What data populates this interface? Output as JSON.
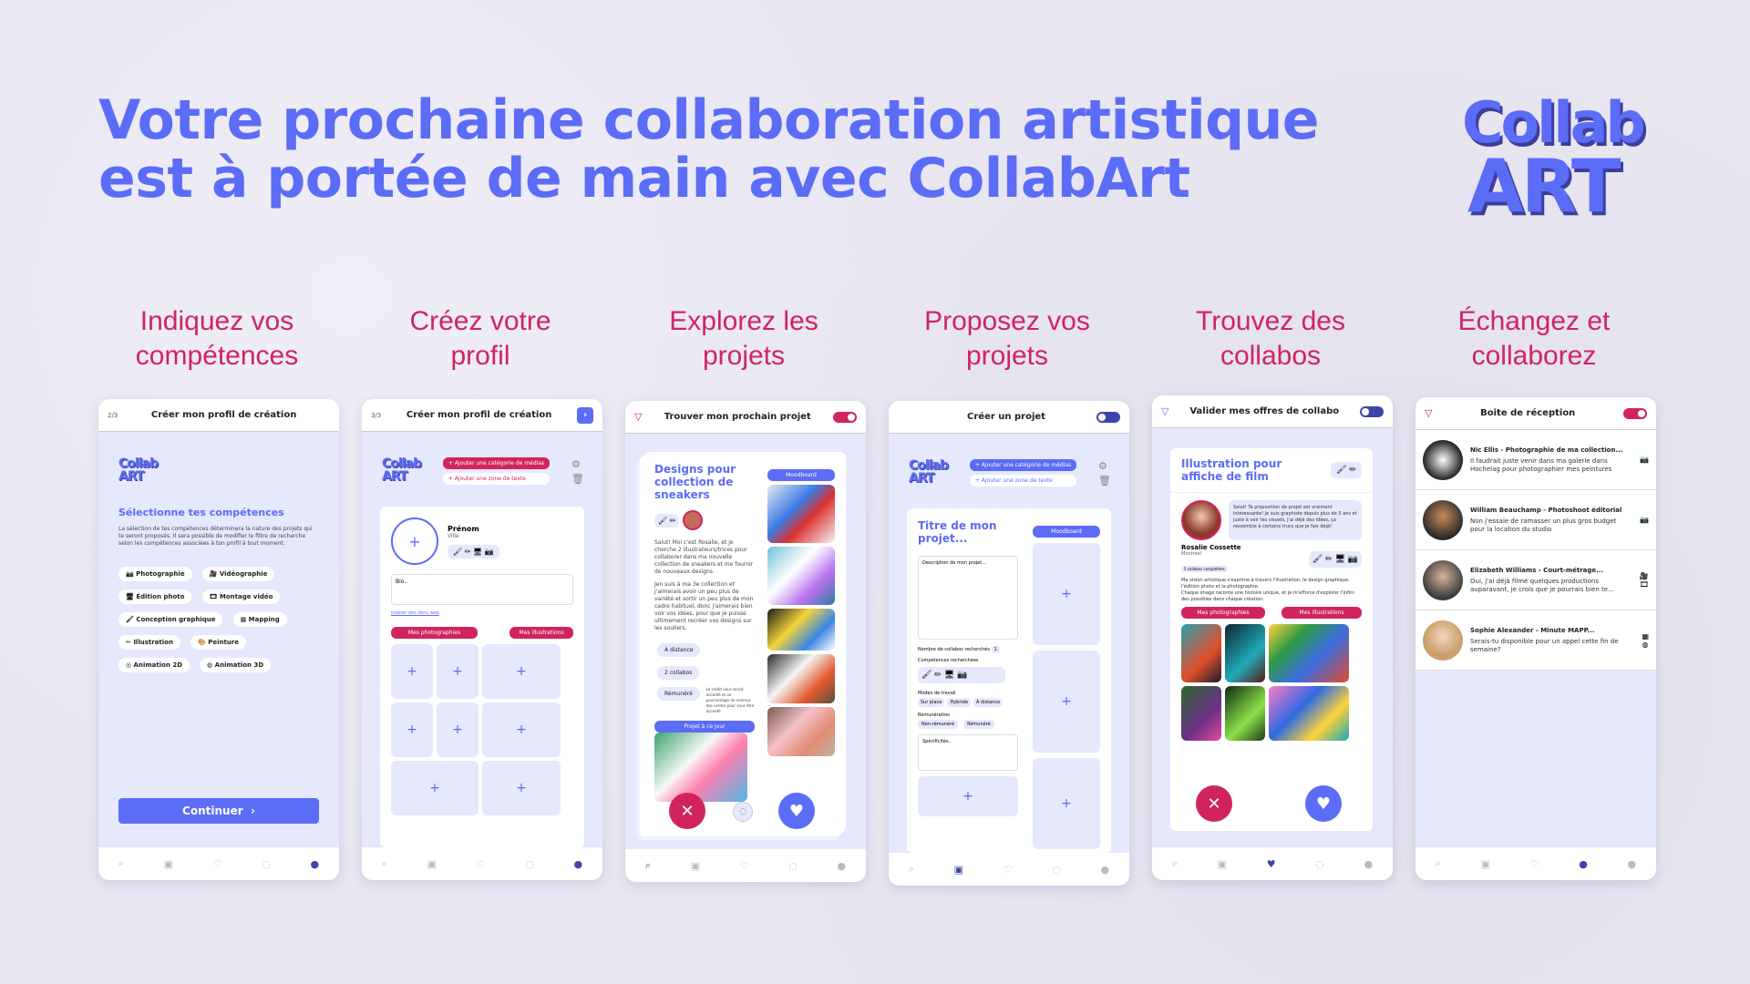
{
  "headline": {
    "line1": "Votre prochaine collaboration artistique",
    "line2": "est à portée de main avec CollabArt"
  },
  "logo": {
    "line1": "Collab",
    "line2": "ART"
  },
  "steps": [
    {
      "title1": "Indiquez vos",
      "title2": "compétences"
    },
    {
      "title1": "Créez votre",
      "title2": "profil"
    },
    {
      "title1": "Explorez les",
      "title2": "projets"
    },
    {
      "title1": "Proposez vos",
      "title2": "projets"
    },
    {
      "title1": "Trouvez des",
      "title2": "collabos"
    },
    {
      "title1": "Échangez et",
      "title2": "collaborez"
    }
  ],
  "screen1": {
    "step": "2/3",
    "header": "Créer mon profil de création",
    "heading": "Sélectionne tes compétences",
    "desc": "La sélection de tes compétences déterminera la nature des projets qui te seront proposés. Il sera possible de modifier le filtre de recherche selon les compétences associées à ton profil à tout moment.",
    "skills": [
      "Photographie",
      "Vidéographie",
      "Édition photo",
      "Montage vidéo",
      "Conception graphique",
      "Mapping",
      "Illustration",
      "Peinture",
      "Animation 2D",
      "Animation 3D"
    ],
    "continue": "Continuer"
  },
  "screen2": {
    "step": "3/3",
    "header": "Créer mon profil de création",
    "add_media": "Ajouter une catégorie de médias",
    "add_text": "Ajouter une zone de texte",
    "firstname": "Prénom",
    "city": "Ville",
    "bio": "Bio..",
    "link": "insérer des liens web",
    "tab1": "Mes photographies",
    "tab2": "Mes illustrations"
  },
  "screen3": {
    "header": "Trouver mon prochain projet",
    "title": "Designs pour collection de sneakers",
    "moodboard": "Moodboard",
    "body1": "Salut! Moi c'est Rosalie, et je cherche 2 illustrateurs/trices pour collaborer dans ma nouvelle collection de sneakers et me fournir de nouveaux designs.",
    "body2": "Jen suis à ma 3e collection et j'aimerais avoir un peu plus de variété et sortir un peu plus de mon cadre habituel, donc j'aimerais bien voir vos idées, pour que je puisse ultimement recréer vos designs sur les souliers.",
    "tag1": "À distance",
    "tag2": "2 collabos",
    "tag3": "Rémunéré",
    "note": "Le crédit vous serait accordé et un pourcentage de revenus des ventes pour vous être accordé",
    "projet": "Projet à ce jour"
  },
  "screen4": {
    "header": "Créer un projet",
    "add_media": "Ajouter une catégorie de médias",
    "add_text": "Ajouter une zone de texte",
    "title": "Titre de mon projet...",
    "moodboard": "Moodboard",
    "desc": "Description de mon projet...",
    "count_label": "Nombre de collabos recherchés",
    "count": "1",
    "skills_label": "Compétences recherchées",
    "mode_label": "Modes de travail",
    "modes": [
      "Sur place",
      "Hybride",
      "À distance"
    ],
    "pay_label": "Rémunération",
    "pays": [
      "Non-rémunéré",
      "Rémunéré"
    ],
    "specs": "Spécificités.."
  },
  "screen5": {
    "header": "Valider mes offres de collabo",
    "title": "Illustration pour affiche de film",
    "message": "Salut! Ta proposition de projet est vraiment intéressante! Je suis graphiste depuis plus de 5 ans et juste à voir tes visuels, j'ai déjà des idées, ça ressemble à certains trucs que je fais déjà!",
    "name": "Rosalie Cossette",
    "city": "Montréal",
    "badge": "5 collabos complétées",
    "bio1": "Ma vision artistique s'exprime à travers l'illustration, le design graphique, l'édition photo et la photographie.",
    "bio2": "Chaque image raconte une histoire unique, et je m'efforce d'explorer l'infini des possibles dans chaque création.",
    "tab1": "Mes photographies",
    "tab2": "Mes illustrations"
  },
  "screen6": {
    "header": "Boite de réception",
    "rows": [
      {
        "name": "Nic Ellis - Photographie de ma collection...",
        "msg": "Il faudrait juste venir dans ma galerie dans Hochelag pour photographier mes peintures"
      },
      {
        "name": "William Beauchamp - Photoshoot éditorial",
        "msg": "Non j'essaie de ramasser un plus gros budget pour la location du studio"
      },
      {
        "name": "Elizabeth Williams - Court-métrage...",
        "msg": "Oui, j'ai déjà filmé quelques productions auparavant, je crois que je pourrais bien te..."
      },
      {
        "name": "Sophie Alexander - Minute MAPP...",
        "msg": "Serais-tu disponible pour un appel cette fin de semaine?"
      }
    ]
  },
  "colors": {
    "brand": "#5b6cf6",
    "accent": "#d1245e",
    "bg": "#e8e6f1"
  }
}
